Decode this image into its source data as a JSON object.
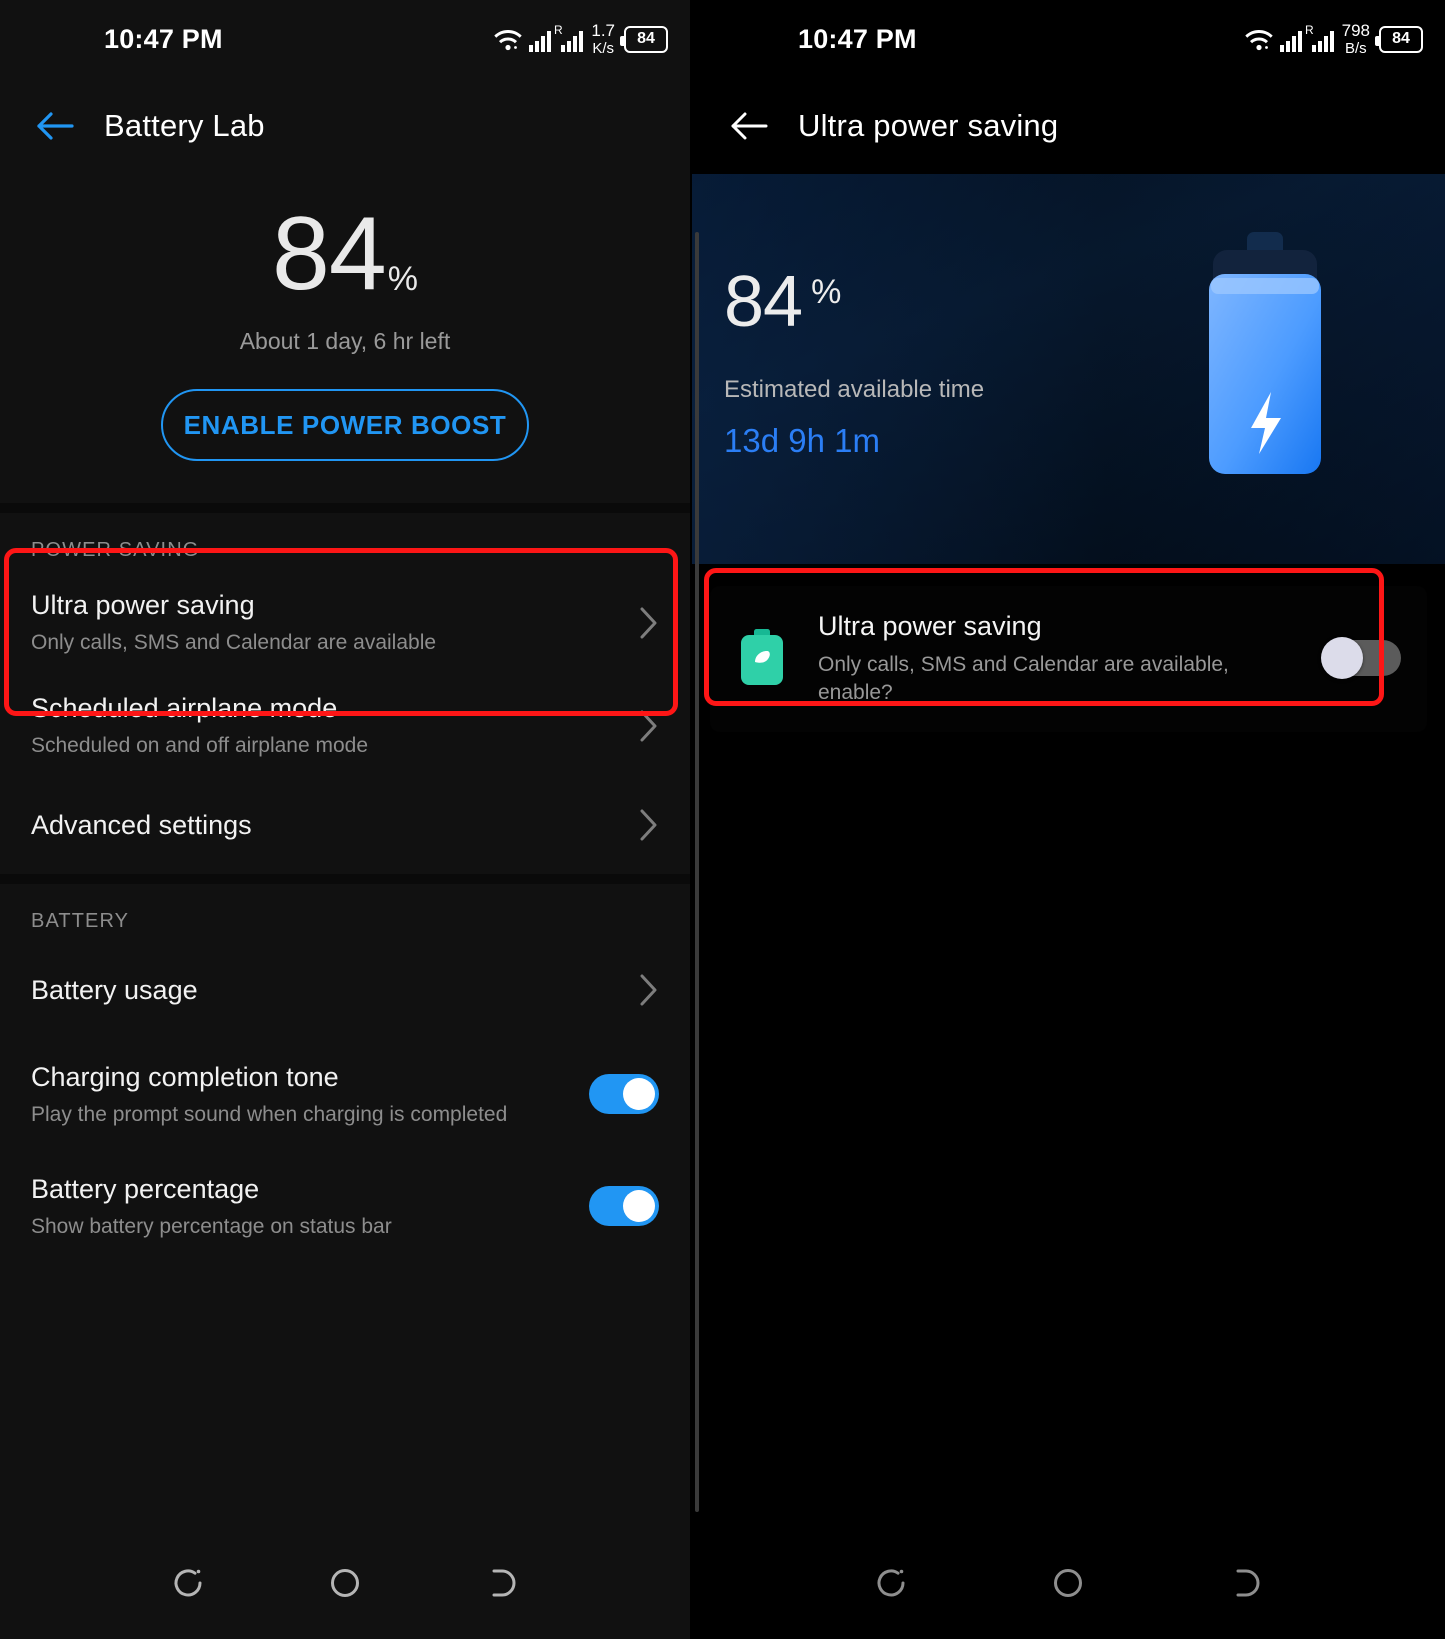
{
  "left_phone": {
    "status_bar": {
      "time": "10:47 PM",
      "wifi_icon": "wifi-icon",
      "signal_icon": "cellular-signal-icon",
      "roaming_label": "R",
      "net_speed_value": "1.7",
      "net_speed_unit": "K/s",
      "battery_level": "84"
    },
    "app_bar": {
      "back_icon": "back-arrow-icon",
      "title": "Battery Lab"
    },
    "hero": {
      "percent": "84",
      "percent_symbol": "%",
      "time_left": "About 1 day, 6 hr left",
      "boost_button": "ENABLE POWER BOOST"
    },
    "sections": [
      {
        "header": "POWER SAVING",
        "rows": [
          {
            "title": "Ultra power saving",
            "subtitle": "Only calls, SMS and Calendar are available",
            "control": "chevron",
            "highlighted": true
          },
          {
            "title": "Scheduled airplane mode",
            "subtitle": "Scheduled on and off airplane mode",
            "control": "chevron",
            "highlighted": false
          },
          {
            "title": "Advanced settings",
            "subtitle": "",
            "control": "chevron",
            "highlighted": false
          }
        ]
      },
      {
        "header": "BATTERY",
        "rows": [
          {
            "title": "Battery usage",
            "subtitle": "",
            "control": "chevron",
            "highlighted": false
          },
          {
            "title": "Charging completion tone",
            "subtitle": "Play the prompt sound when charging is completed",
            "control": "switch",
            "switch_state": "on",
            "highlighted": false
          },
          {
            "title": "Battery percentage",
            "subtitle": "Show battery percentage on status bar",
            "control": "switch",
            "switch_state": "on",
            "highlighted": false
          }
        ]
      }
    ],
    "nav_bar": {
      "recents_icon": "recents-icon",
      "home_icon": "home-circle-icon",
      "back_icon": "back-nav-icon"
    }
  },
  "right_phone": {
    "status_bar": {
      "time": "10:47 PM",
      "wifi_icon": "wifi-icon",
      "signal_icon": "cellular-signal-icon",
      "roaming_label": "R",
      "net_speed_value": "798",
      "net_speed_unit": "B/s",
      "battery_level": "84"
    },
    "app_bar": {
      "back_icon": "back-arrow-icon",
      "title": "Ultra power saving"
    },
    "hero": {
      "percent": "84",
      "percent_symbol": "%",
      "estimate_label": "Estimated available time",
      "estimate_value": "13d 9h 1m",
      "battery_art_icon": "battery-charging-illustration"
    },
    "card": {
      "icon": "green-battery-leaf-icon",
      "title": "Ultra power saving",
      "subtitle": "Only calls, SMS and Calendar are available, enable?",
      "switch_state": "off",
      "highlighted": true
    },
    "nav_bar": {
      "recents_icon": "recents-icon",
      "home_icon": "home-circle-icon",
      "back_icon": "back-nav-icon"
    }
  },
  "annotations": {
    "highlight_color": "#fe1616"
  },
  "theme": {
    "accent_blue": "#2196f3",
    "link_blue": "#2b7ef5",
    "green": "#2fd0a8",
    "bg_left": "#111111",
    "bg_right": "#000000",
    "text_primary": "#f2f2f2",
    "text_secondary": "#8d8d8d"
  }
}
